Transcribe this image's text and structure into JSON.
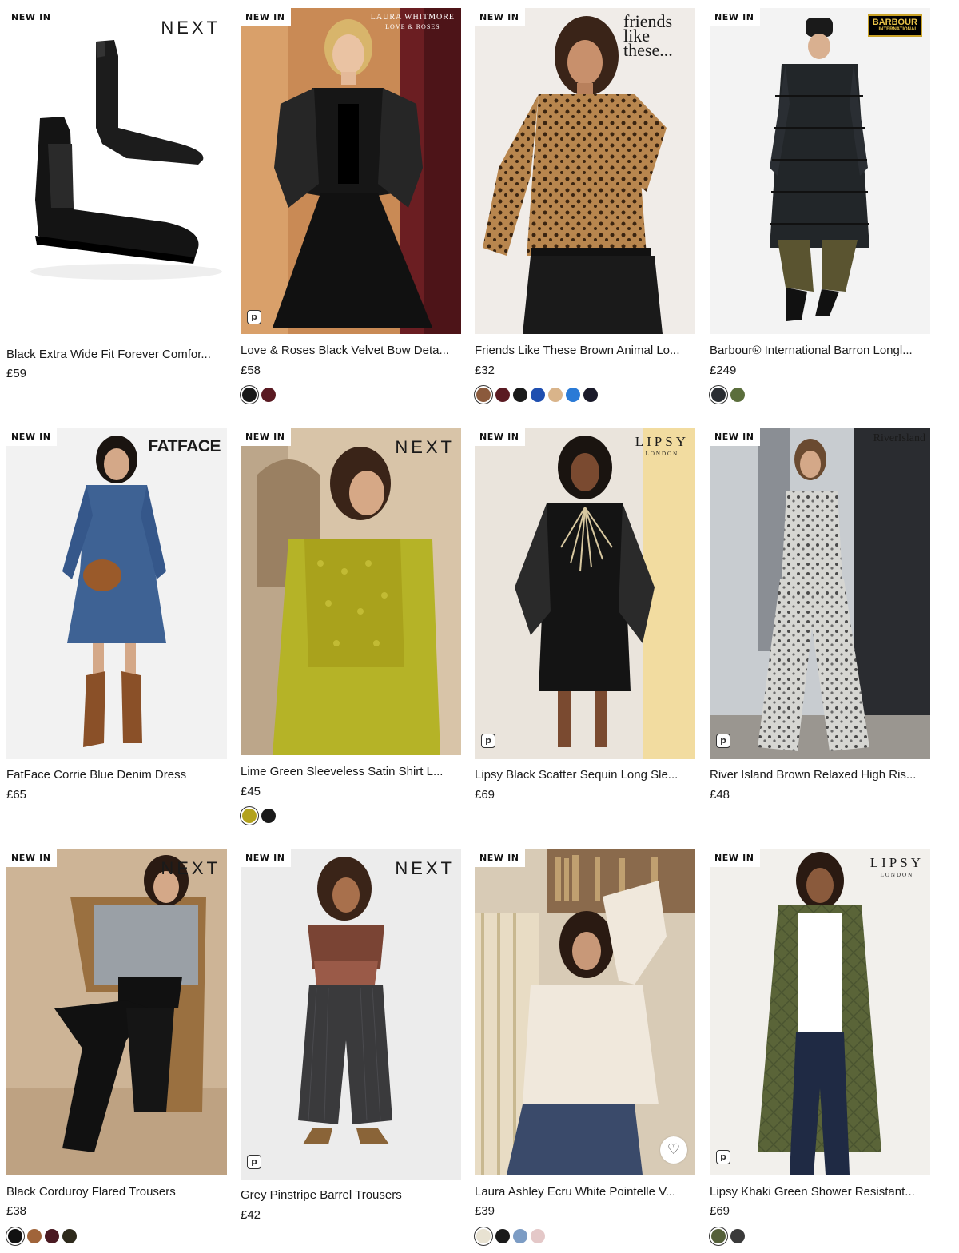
{
  "products": [
    {
      "badge": "NEW IN",
      "brand": "NEXT",
      "title": "Black Extra Wide Fit Forever Comfor...",
      "price": "£59",
      "swatches": []
    },
    {
      "badge": "NEW IN",
      "brand": "LAURA WHITMORE",
      "brand_sub": "LOVE & ROSES",
      "title": "Love & Roses Black Velvet Bow Deta...",
      "price": "£58",
      "swatches": [
        "#1a1a1a",
        "#5a1a22"
      ]
    },
    {
      "badge": "NEW IN",
      "brand": "friends like these...",
      "title": "Friends Like These Brown Animal Lo...",
      "price": "£32",
      "swatches": [
        "#8b5a3c",
        "#5a1a22",
        "#1a1a1a",
        "#1f4fb0",
        "#d9b48a",
        "#2a7ad6",
        "#1a1a2a"
      ]
    },
    {
      "badge": "NEW IN",
      "brand": "BARBOUR",
      "brand_sub": "INTERNATIONAL",
      "title": "Barbour® International Barron Longl...",
      "price": "£249",
      "swatches": [
        "#2a2e33",
        "#5b6e3c"
      ]
    },
    {
      "badge": "NEW IN",
      "brand": "FATFACE",
      "title": "FatFace Corrie Blue Denim Dress",
      "price": "£65",
      "swatches": []
    },
    {
      "badge": "NEW IN",
      "brand": "NEXT",
      "title": "Lime Green Sleeveless Satin Shirt L...",
      "price": "£45",
      "swatches": [
        "#b3a21d",
        "#1a1a1a"
      ]
    },
    {
      "badge": "NEW IN",
      "brand": "LIPSY",
      "brand_sub": "LONDON",
      "title": "Lipsy Black Scatter Sequin Long Sle...",
      "price": "£69",
      "swatches": []
    },
    {
      "badge": "NEW IN",
      "brand": "RiverIsland",
      "title": "River Island Brown Relaxed High Ris...",
      "price": "£48",
      "swatches": []
    },
    {
      "badge": "NEW IN",
      "brand": "NEXT",
      "title": "Black Corduroy Flared Trousers",
      "price": "£38",
      "swatches": [
        "#111111",
        "#a0643a",
        "#4a1a22",
        "#2e2a1c"
      ]
    },
    {
      "badge": "NEW IN",
      "brand": "NEXT",
      "title": "Grey Pinstripe Barrel Trousers",
      "price": "£42",
      "swatches": []
    },
    {
      "badge": "NEW IN",
      "brand": "",
      "title": "Laura Ashley Ecru White Pointelle V...",
      "price": "£39",
      "swatches": [
        "#e8e2d2",
        "#1a1a1a",
        "#7c9cc4",
        "#e4c8c8"
      ]
    },
    {
      "badge": "NEW IN",
      "brand": "LIPSY",
      "brand_sub": "LONDON",
      "title": "Lipsy Khaki Green Shower Resistant...",
      "price": "£69",
      "swatches": [
        "#55603a",
        "#3a3a3a"
      ]
    }
  ],
  "icons": {
    "pin": "p",
    "heart": "♡"
  }
}
